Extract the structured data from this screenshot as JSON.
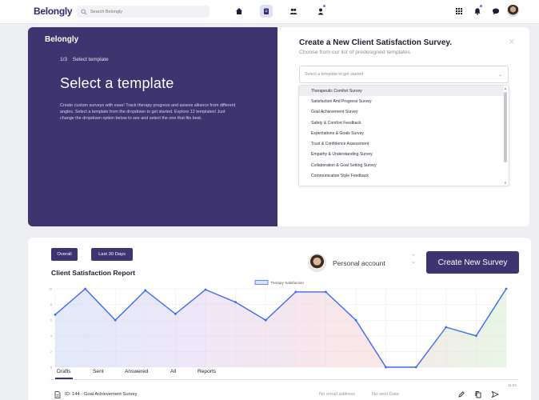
{
  "topbar": {
    "logo": "Belongly",
    "search_placeholder": "Search Belongly",
    "nav_icons": [
      "home-icon",
      "clipboard-icon",
      "people-icon",
      "person-badge-icon"
    ],
    "right_icons": [
      "grid-icon",
      "bell-icon",
      "chat-icon"
    ]
  },
  "modal": {
    "left": {
      "logo": "Belongly",
      "step_number": "1/3",
      "step_label": "Select template",
      "heading": "Select a template",
      "description": "Create custom surveys with ease! Track therapy progress and assess alliance from different angles. Select a template from the dropdown to get started. Explore 12 templates! Just change the dropdown option below to see and select the one that fits best."
    },
    "right": {
      "title": "Create a New Client Satisfaction Survey.",
      "subtitle": "Choose from our list of predesigned templates",
      "select_placeholder": "Select a template to get started",
      "options": [
        "Therapeutic Comfort Survey",
        "Satisfaction And Progress Survey",
        "Goal Achievement Survey",
        "Safety & Comfort Feedback",
        "Expectations & Goals Survey",
        "Trust & Confidence Assessment",
        "Empathy & Understanding Survey",
        "Collaboration & Goal Setting Survey",
        "Communication Style Feedback"
      ],
      "selected_index": 0,
      "close_glyph": "×"
    }
  },
  "dashboard": {
    "filters": [
      "Overall",
      "Last 30 Days"
    ],
    "report_title": "Client Satisfaction Report",
    "account_label": "Personal account",
    "create_button": "Create New Survey",
    "tabs": [
      "Drafts",
      "Sent",
      "Answered",
      "All",
      "Reports"
    ],
    "active_tab": "Drafts",
    "timestamp": "11:24",
    "rows": [
      {
        "title": "ID: 144 - Goal Achievement Survey",
        "email": "No email address",
        "sent": "No sent Date"
      }
    ]
  },
  "chart_data": {
    "type": "line",
    "legend": [
      "Therapy Satisfaction"
    ],
    "legend_position": "top-center",
    "y_ticks": [
      "10",
      "8",
      "6",
      "4",
      "2",
      "0"
    ],
    "ylim": [
      0,
      10
    ],
    "grid": true,
    "series": [
      {
        "name": "Therapy Satisfaction",
        "values": [
          6.7,
          10,
          6,
          9.8,
          6.8,
          9.9,
          8.3,
          6,
          9.6,
          9.6,
          6,
          0,
          0,
          5.1,
          4,
          10
        ]
      }
    ],
    "colors": {
      "line": "#3a6cf2",
      "point": "#3a6cf2"
    }
  },
  "colors": {
    "brand": "#3d3470",
    "accent": "#3a6cf2"
  }
}
